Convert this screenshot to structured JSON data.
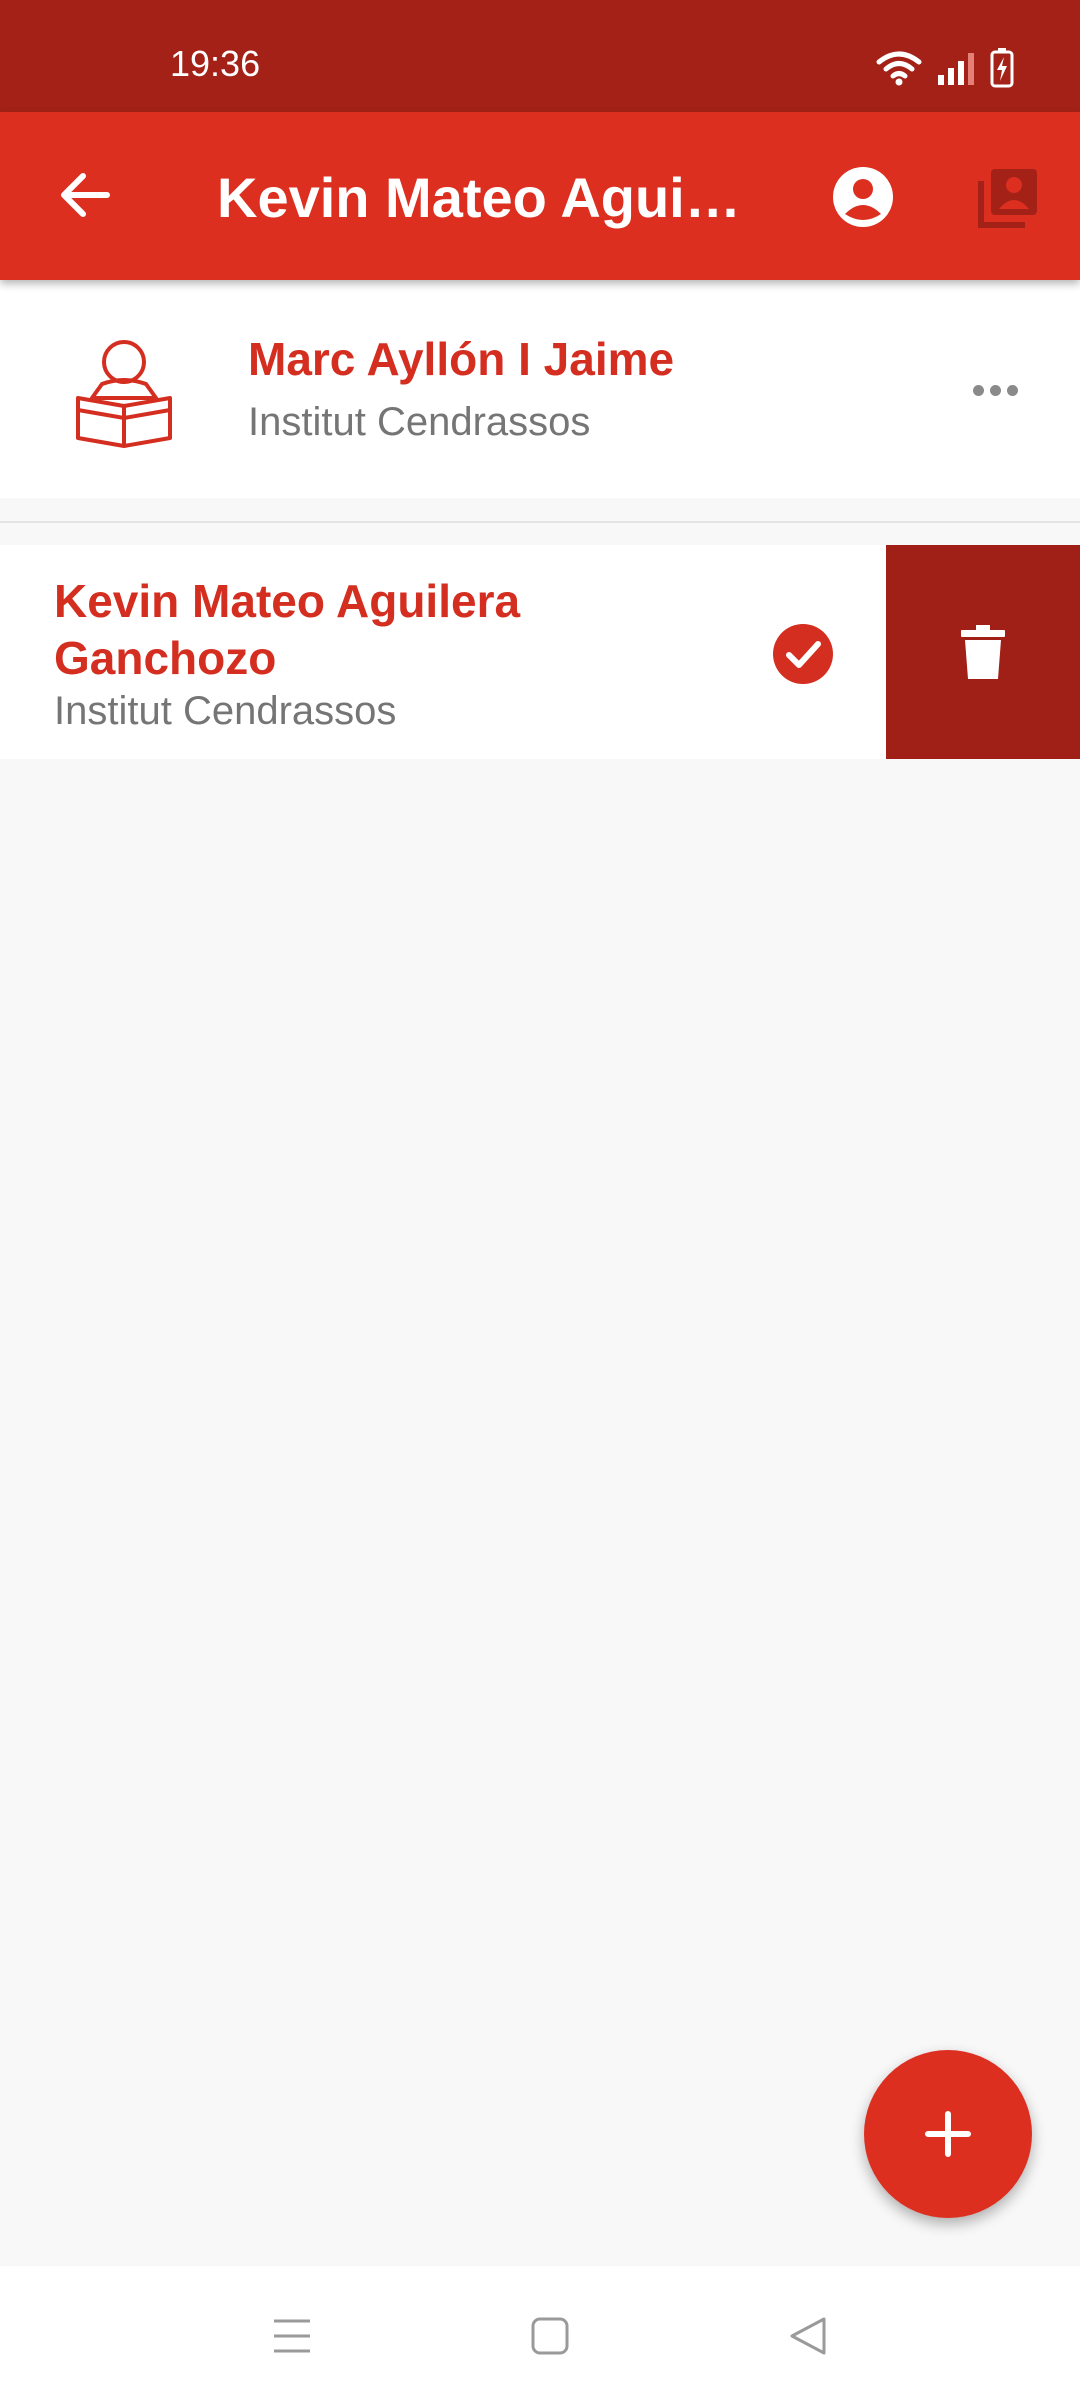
{
  "status_bar": {
    "time": "19:36",
    "icons": [
      "wifi-icon",
      "signal-icon",
      "battery-charging-icon"
    ]
  },
  "app_bar": {
    "title": "Kevin Mateo Aguilera Ganchozo",
    "icons": [
      "back-arrow-icon",
      "account-circle-icon",
      "contacts-stack-icon"
    ]
  },
  "teacher": {
    "name": "Marc Ayllón I Jaime",
    "school": "Institut Cendrassos",
    "icon": "reader-person-icon"
  },
  "students": [
    {
      "name": "Kevin Mateo Aguilera Ganchozo",
      "school": "Institut Cendrassos",
      "selected": true,
      "action_icon": "trash-icon"
    }
  ],
  "fab": {
    "icon": "plus-icon"
  },
  "nav_bar": {
    "icons": [
      "menu-icon",
      "home-square-icon",
      "back-triangle-icon"
    ]
  },
  "colors": {
    "status_bar": "#a32117",
    "primary": "#dc2f20",
    "accent_text": "#d42e20",
    "delete_bg": "#a01f16",
    "secondary_text": "#757575",
    "background": "#f8f8f8"
  }
}
